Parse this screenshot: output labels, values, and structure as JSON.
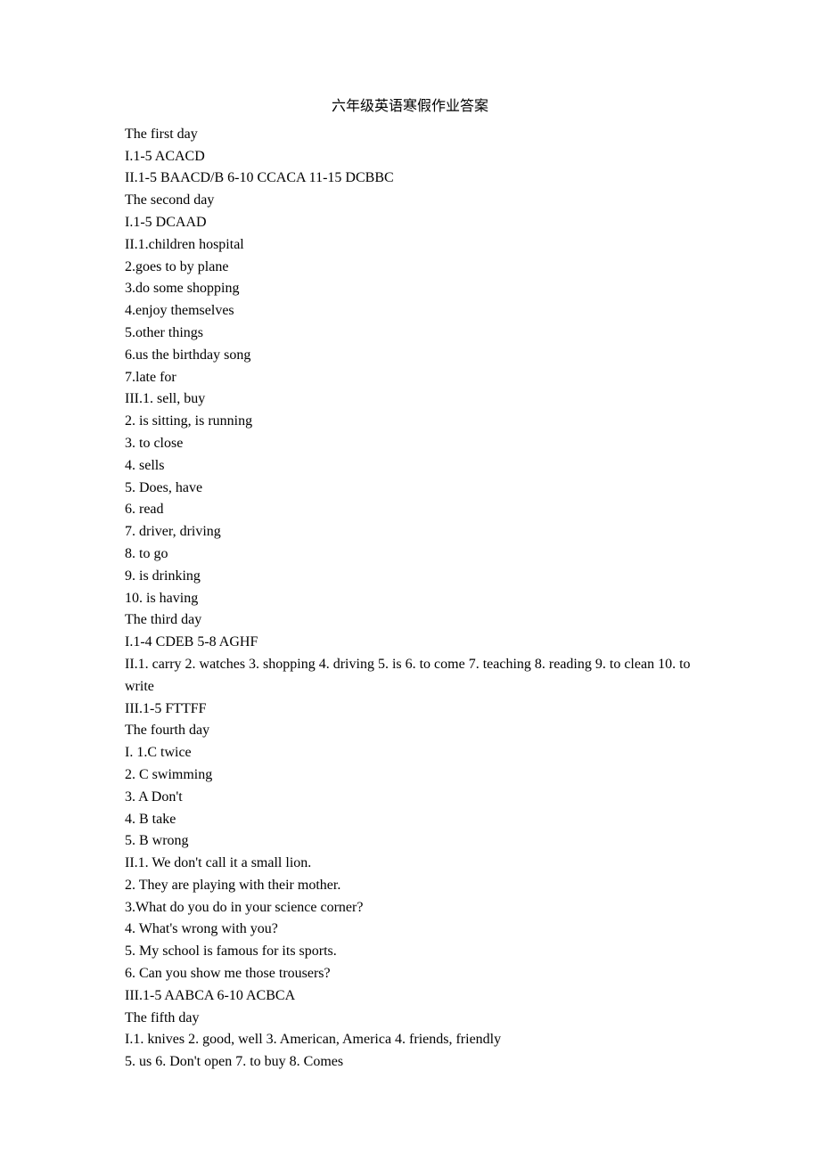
{
  "title": "六年级英语寒假作业答案",
  "lines": [
    "The first day",
    "I.1-5 ACACD",
    "II.1-5 BAACD/B 6-10 CCACA 11-15 DCBBC",
    "The second day",
    "I.1-5 DCAAD",
    "II.1.children hospital",
    "2.goes to by plane",
    "3.do some shopping",
    "4.enjoy themselves",
    "5.other things",
    "6.us the birthday song",
    "7.late for",
    "III.1. sell, buy",
    "2. is sitting, is running",
    "3. to close",
    "4. sells",
    "5. Does, have",
    "6. read",
    "7. driver, driving",
    "8. to go",
    "9. is drinking",
    "10. is having",
    "The third day",
    "I.1-4 CDEB 5-8 AGHF",
    "II.1. carry 2. watches 3. shopping 4. driving 5. is 6. to come 7. teaching 8. reading 9. to clean 10. to write",
    "III.1-5 FTTFF",
    "The fourth day",
    "I. 1.C twice",
    "2. C swimming",
    "3. A Don't",
    "4. B take",
    "5. B wrong",
    "II.1. We don't call it a small lion.",
    "2. They are playing with their mother.",
    "3.What do you do in your science corner?",
    "4. What's wrong with you?",
    "5. My school is famous for its sports.",
    "6. Can you show me those trousers?",
    "III.1-5 AABCA 6-10 ACBCA",
    "The fifth day",
    "I.1. knives 2. good, well 3. American, America 4. friends, friendly",
    "5. us 6. Don't open 7. to buy 8. Comes"
  ]
}
